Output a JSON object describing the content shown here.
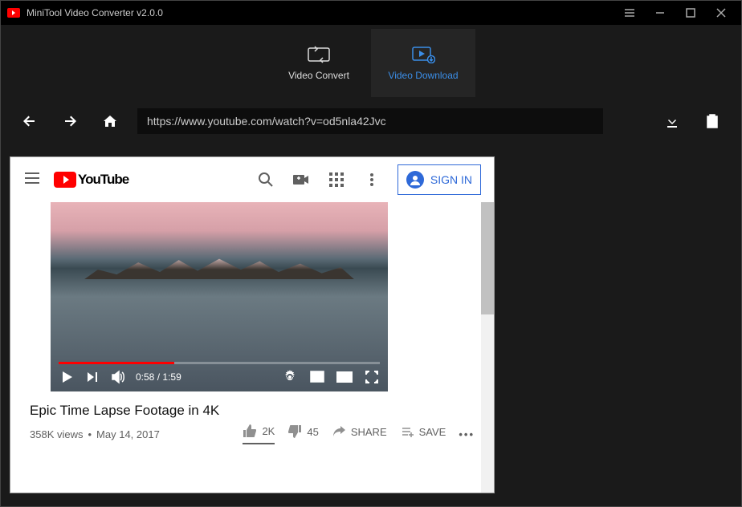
{
  "app": {
    "title": "MiniTool Video Converter v2.0.0"
  },
  "modes": {
    "convert": "Video Convert",
    "download": "Video Download"
  },
  "url": "https://www.youtube.com/watch?v=od5nla42Jvc",
  "youtube": {
    "brand": "YouTube",
    "signin": "SIGN IN",
    "video": {
      "title": "Epic Time Lapse Footage in 4K",
      "views": "358K views",
      "sep": "•",
      "date": "May 14, 2017",
      "time_current": "0:58",
      "time_sep": "/",
      "time_total": "1:59",
      "likes": "2K",
      "dislikes": "45",
      "share": "SHARE",
      "save": "SAVE"
    }
  }
}
